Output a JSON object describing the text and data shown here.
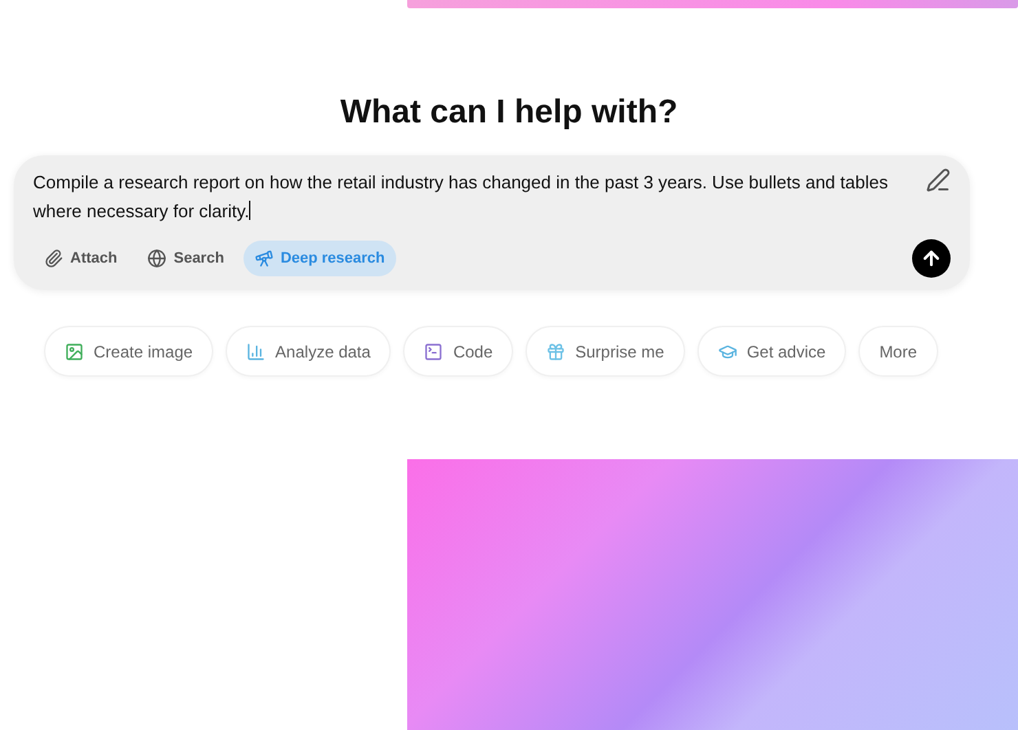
{
  "heading": "What can I help with?",
  "composer": {
    "value": "Compile a research report on how the retail industry has changed in the past 3 years. Use bullets and tables where necessary for clarity.",
    "tools": [
      {
        "label": "Attach",
        "kind": "attach",
        "selected": false
      },
      {
        "label": "Search",
        "kind": "search",
        "selected": false
      },
      {
        "label": "Deep research",
        "kind": "research",
        "selected": true
      }
    ]
  },
  "suggestions": [
    {
      "label": "Create image",
      "kind": "image",
      "color": "#3fae5a"
    },
    {
      "label": "Analyze data",
      "kind": "chart",
      "color": "#5ab4e0"
    },
    {
      "label": "Code",
      "kind": "code",
      "color": "#8a6fd1"
    },
    {
      "label": "Surprise me",
      "kind": "gift",
      "color": "#6cc1e6"
    },
    {
      "label": "Get advice",
      "kind": "advice",
      "color": "#5ab4e0"
    },
    {
      "label": "More",
      "kind": "more"
    }
  ]
}
